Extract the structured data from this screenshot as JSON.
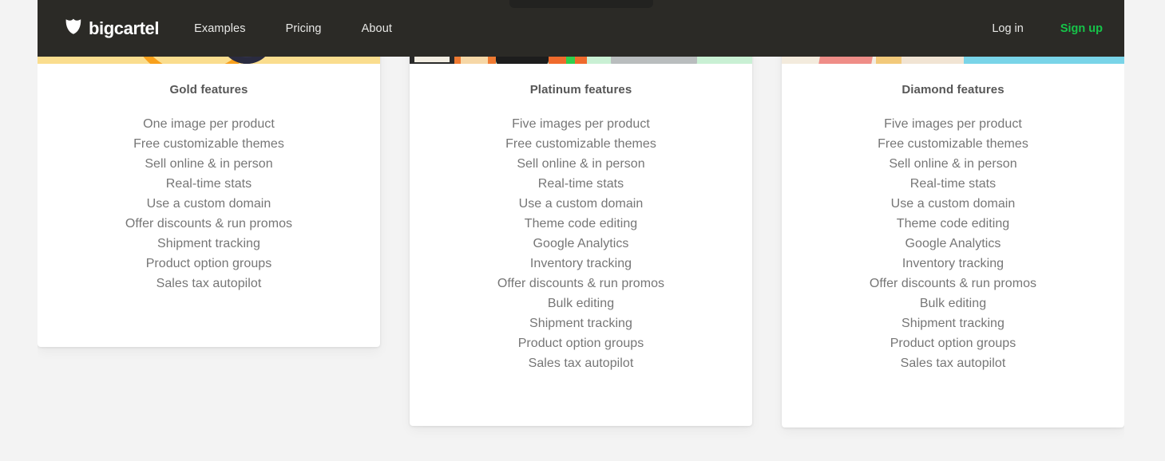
{
  "nav": {
    "logo_text": "bigcartel",
    "logo_icon": "bigcartel-shield-icon",
    "links": [
      {
        "label": "Examples"
      },
      {
        "label": "Pricing"
      },
      {
        "label": "About"
      }
    ],
    "login_label": "Log in",
    "signup_label": "Sign up",
    "bar_color": "#2b2a26",
    "signup_color": "#16c449",
    "link_color": "#e8e8e6"
  },
  "page": {
    "background_color": "#f3f3f3",
    "card_background": "#ffffff",
    "title_color": "#575757",
    "feature_color": "#767676"
  },
  "cards": [
    {
      "title": "Gold features",
      "photo_name": "gold-plan-photo",
      "features": [
        "One image per product",
        "Free customizable themes",
        "Sell online & in person",
        "Real-time stats",
        "Use a custom domain",
        "Offer discounts & run promos",
        "Shipment tracking",
        "Product option groups",
        "Sales tax autopilot"
      ]
    },
    {
      "title": "Platinum features",
      "photo_name": "platinum-plan-photo",
      "features": [
        "Five images per product",
        "Free customizable themes",
        "Sell online & in person",
        "Real-time stats",
        "Use a custom domain",
        "Theme code editing",
        "Google Analytics",
        "Inventory tracking",
        "Offer discounts & run promos",
        "Bulk editing",
        "Shipment tracking",
        "Product option groups",
        "Sales tax autopilot"
      ]
    },
    {
      "title": "Diamond features",
      "photo_name": "diamond-plan-photo",
      "features": [
        "Five images per product",
        "Free customizable themes",
        "Sell online & in person",
        "Real-time stats",
        "Use a custom domain",
        "Theme code editing",
        "Google Analytics",
        "Inventory tracking",
        "Offer discounts & run promos",
        "Bulk editing",
        "Shipment tracking",
        "Product option groups",
        "Sales tax autopilot"
      ]
    }
  ]
}
